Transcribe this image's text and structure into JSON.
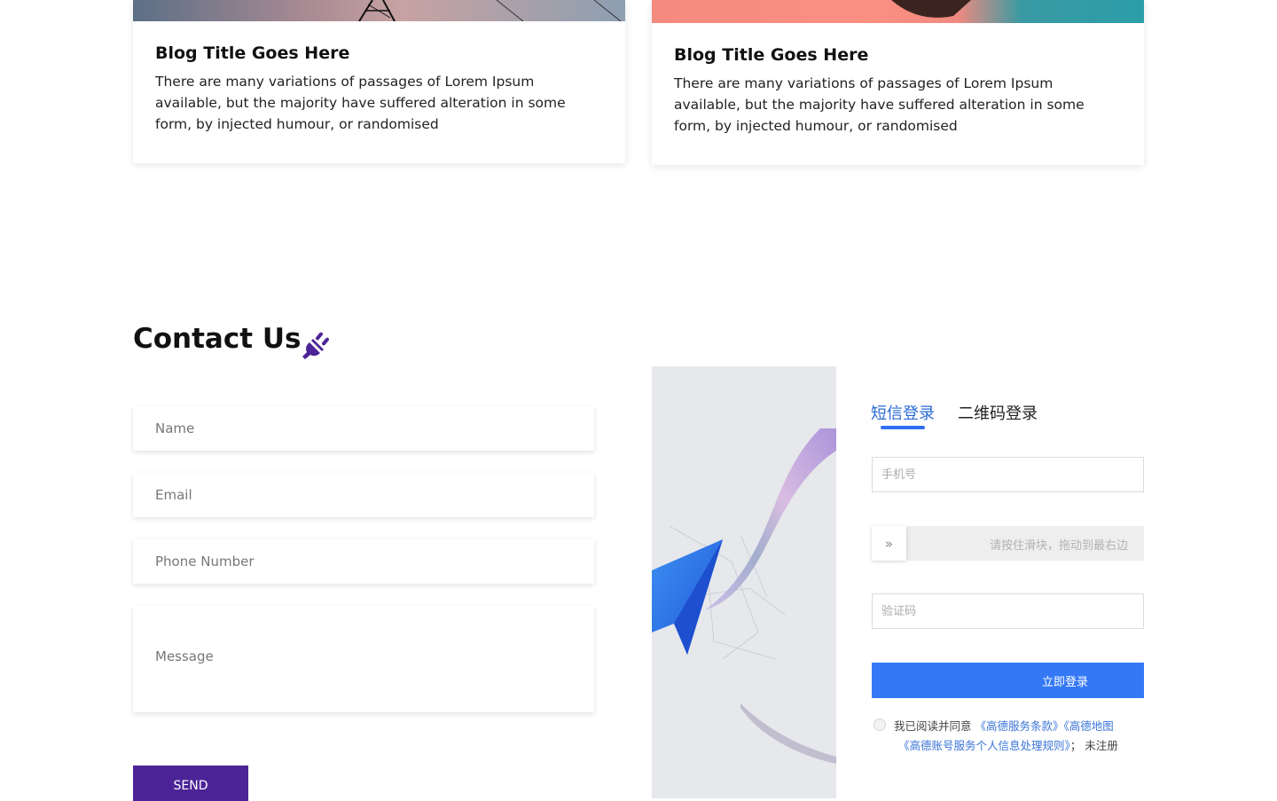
{
  "blog": {
    "cards": [
      {
        "title": "Blog Title Goes Here",
        "text": "There are many variations of passages of Lorem Ipsum available, but the majority have suffered alteration in some form, by injected humour, or randomised"
      },
      {
        "title": "Blog Title Goes Here",
        "text": "There are many variations of passages of Lorem Ipsum available, but the majority have suffered alteration in some form, by injected humour, or randomised"
      }
    ]
  },
  "contact": {
    "title": "Contact Us",
    "name_placeholder": "Name",
    "email_placeholder": "Email",
    "phone_placeholder": "Phone Number",
    "message_placeholder": "Message",
    "send_label": "SEND",
    "accent_color": "#4d2497"
  },
  "login": {
    "tabs": [
      {
        "label": "短信登录",
        "active": true
      },
      {
        "label": "二维码登录",
        "active": false
      }
    ],
    "phone_placeholder": "手机号",
    "slider_hint": "请按住滑块，拖动到最右边",
    "code_placeholder": "验证码",
    "submit_label": "立即登录",
    "agree_prefix": "我已阅读并同意",
    "terms_link": "《高德服务条款》",
    "map_link": "《高德地图",
    "privacy_link": "《高德账号服务个人信息处理规则》",
    "privacy_suffix": "；  未注册",
    "primary_color": "#3478f6"
  }
}
